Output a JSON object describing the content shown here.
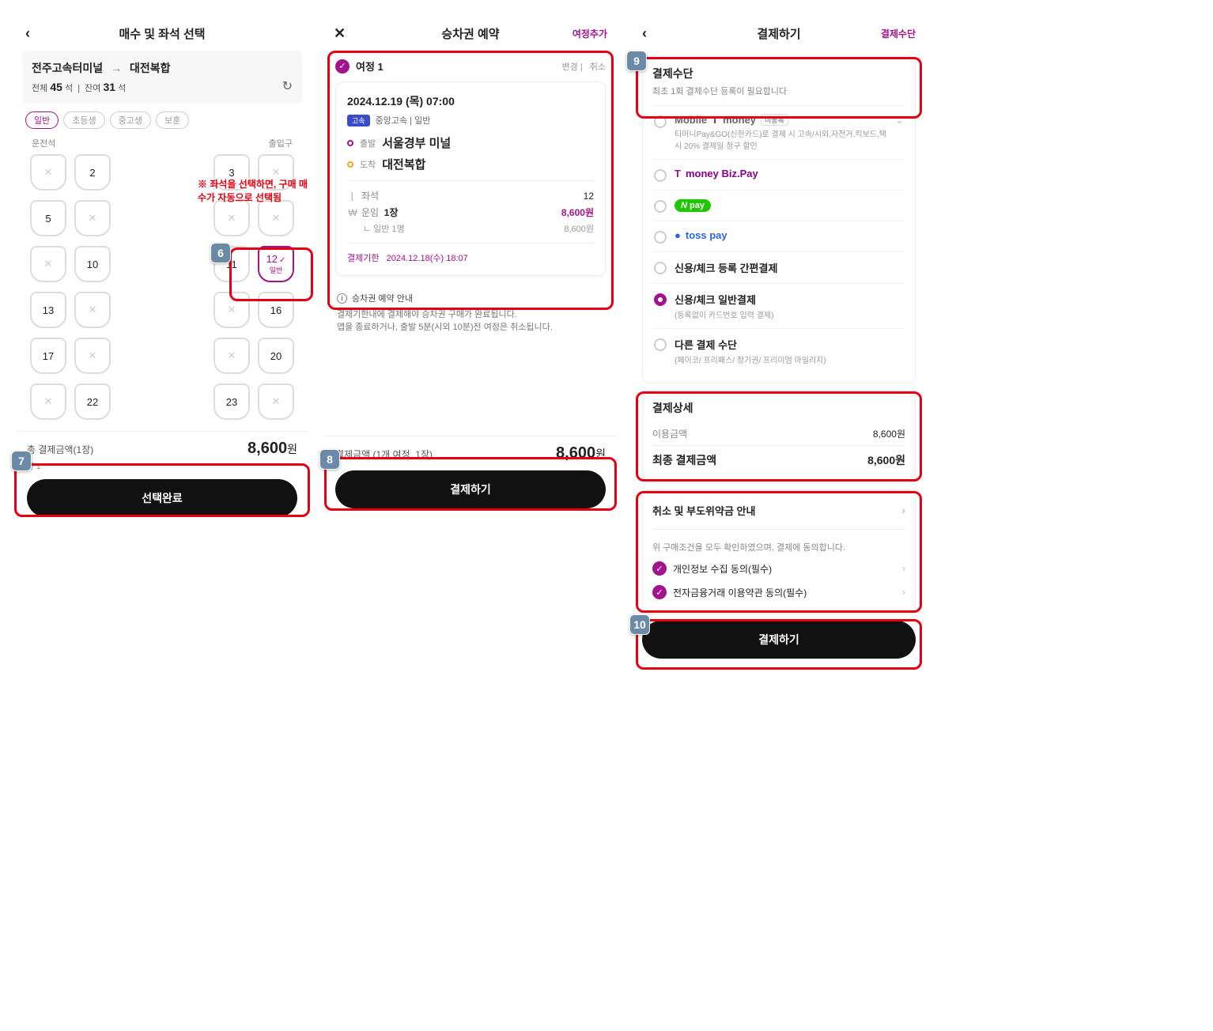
{
  "panel1": {
    "title": "매수 및 좌석 선택",
    "route_from": "전주고속터미널",
    "route_arrow": "→",
    "route_to": "대전복합",
    "total_label": "전체",
    "total_num": "45",
    "total_unit": "석",
    "remain_label": "잔여",
    "remain_num": "31",
    "remain_unit": "석",
    "tags": {
      "a": "일반",
      "b": "초등생",
      "c": "중고생",
      "d": "보훈"
    },
    "driver": "운전석",
    "exit": "출입구",
    "seats": {
      "l": [
        "2",
        "5",
        "10",
        "13",
        "17",
        "22"
      ],
      "r": [
        "3",
        "11",
        "12",
        "16",
        "20",
        "23"
      ]
    },
    "seat_sub": "일반",
    "note": "※ 좌석을 선택하면, 구매 매수가 자동으로 선택됨",
    "badge6": "6",
    "total_lbl": "총 결제금액(1장)",
    "amount": "8,600",
    "won": "원",
    "sublabel": "반 1",
    "badge7": "7",
    "btn": "선택완료"
  },
  "panel2": {
    "title": "승차권 예약",
    "add": "여정추가",
    "journey": "여정 1",
    "change": "변경",
    "cancel": "취소",
    "datetime": "2024.12.19 (목) 07:00",
    "chip": "고속",
    "operator": "중앙고속",
    "grade": "일반",
    "dep_lbl": "출발",
    "dep": "서울경부 미널",
    "arr_lbl": "도착",
    "arr": "대전복합",
    "seat_k": "좌석",
    "seat_v": "12",
    "fare_k": "운임",
    "fare_cnt": "1장",
    "fare_v": "8,600원",
    "fare_sub_k": "ㄴ 일반 1명",
    "fare_sub_v": "8,600원",
    "deadline_lbl": "결제기한",
    "deadline": "2024.12.18(수) 18:07",
    "info_head": "승차권 예약 안내",
    "info_l1": "결제기한내에 결제해야 승차권 구매가 완료됩니다.",
    "info_l2": "앱을 종료하거나, 출발 5분(시외 10분)전 여정은 취소됩니다.",
    "total_lbl": "결제금액 (1개 여정, 1장)",
    "amount": "8,600",
    "won": "원",
    "badge8": "8",
    "btn": "결제하기"
  },
  "panel3": {
    "title": "결제하기",
    "right": "결제수단",
    "badge9": "9",
    "method_title": "결제수단",
    "method_sub": "최초 1회 결제수단 등록이 필요합니다",
    "opts": {
      "tm": {
        "name": "Mobile Tmoney",
        "badge": "미등록",
        "desc": "티머니Pay&GO(신한카드)로 결제 시 고속/시외,자전거,킥보드,택시 20% 결제일 청구 할인"
      },
      "biz": {
        "name": "Tmoney Biz.Pay"
      },
      "npay": {
        "name": "pay"
      },
      "toss": {
        "name": "toss pay"
      },
      "simple": {
        "name": "신용/체크 등록 간편결제"
      },
      "card": {
        "name": "신용/체크 일반결제",
        "desc": "(등록없이 카드번호 입력 결제)"
      },
      "other": {
        "name": "다른 결제 수단",
        "desc": "(페이코/ 프리패스/ 정기권/ 프리미엄 마일리지)"
      }
    },
    "detail_title": "결제상세",
    "use_lbl": "이용금액",
    "use_val": "8,600원",
    "final_lbl": "최종 결제금액",
    "final_val": "8,600원",
    "cancel_head": "취소 및 부도위약금 안내",
    "agree_txt": "위 구매조건을 모두 확인하였으며, 결제에 동의합니다.",
    "agree1": "개인정보 수집 동의(필수)",
    "agree2": "전자금융거래 이용약관 동의(필수)",
    "badge10": "10",
    "btn": "결제하기"
  }
}
